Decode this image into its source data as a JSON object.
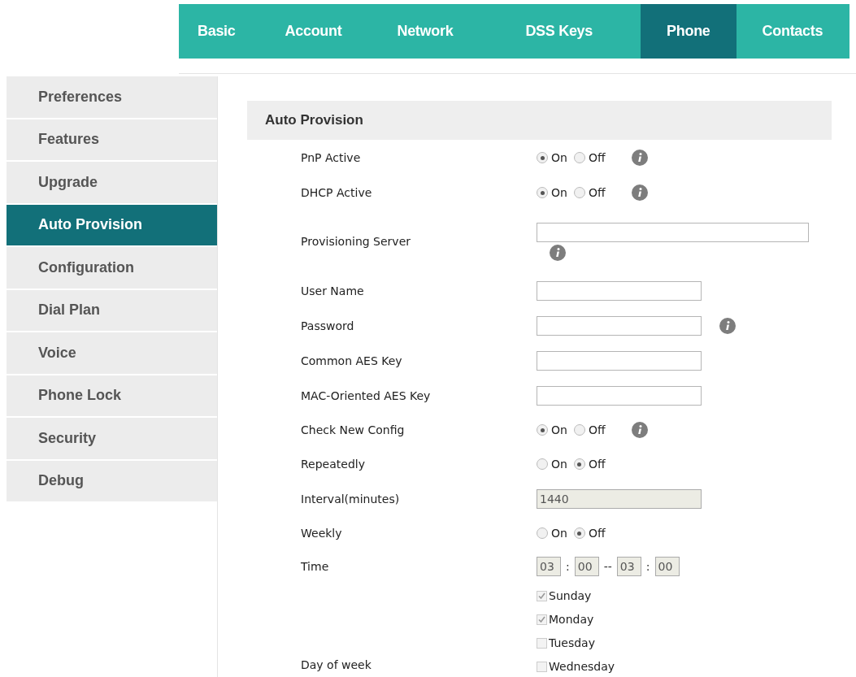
{
  "top_tabs": [
    {
      "label": "Basic",
      "selected": false
    },
    {
      "label": "Account",
      "selected": false
    },
    {
      "label": "Network",
      "selected": false
    },
    {
      "label": "DSS Keys",
      "selected": false
    },
    {
      "label": "Phone",
      "selected": true
    },
    {
      "label": "Contacts",
      "selected": false
    }
  ],
  "sidebar": {
    "items": [
      {
        "label": "Preferences",
        "selected": false
      },
      {
        "label": "Features",
        "selected": false
      },
      {
        "label": "Upgrade",
        "selected": false
      },
      {
        "label": "Auto Provision",
        "selected": true
      },
      {
        "label": "Configuration",
        "selected": false
      },
      {
        "label": "Dial Plan",
        "selected": false
      },
      {
        "label": "Voice",
        "selected": false
      },
      {
        "label": "Phone Lock",
        "selected": false
      },
      {
        "label": "Security",
        "selected": false
      },
      {
        "label": "Debug",
        "selected": false
      }
    ]
  },
  "section": {
    "title": "Auto Provision",
    "rows": [
      {
        "kind": "radio",
        "label": "PnP Active",
        "options": [
          {
            "label": "On",
            "selected": true
          },
          {
            "label": "Off",
            "selected": false
          }
        ],
        "info": true
      },
      {
        "kind": "radio",
        "label": "DHCP Active",
        "options": [
          {
            "label": "On",
            "selected": true
          },
          {
            "label": "Off",
            "selected": false
          }
        ],
        "info": true
      },
      {
        "kind": "wide_input",
        "label": "Provisioning Server",
        "info": true
      },
      {
        "kind": "input",
        "label": "User Name",
        "info": false
      },
      {
        "kind": "input",
        "label": "Password",
        "info": true
      },
      {
        "kind": "input",
        "label": "Common AES Key",
        "info": false
      },
      {
        "kind": "input",
        "label": "MAC-Oriented AES Key",
        "info": false
      },
      {
        "kind": "radio",
        "label": "Check New Config",
        "options": [
          {
            "label": "On",
            "selected": true
          },
          {
            "label": "Off",
            "selected": false
          }
        ],
        "info": true
      },
      {
        "kind": "radio",
        "label": "Repeatedly",
        "options": [
          {
            "label": "On",
            "selected": false
          },
          {
            "label": "Off",
            "selected": true
          }
        ],
        "info": false
      },
      {
        "kind": "input",
        "label": "Interval(minutes)",
        "value": "1440",
        "disabled": true,
        "info": false
      },
      {
        "kind": "radio",
        "label": "Weekly",
        "options": [
          {
            "label": "On",
            "selected": false
          },
          {
            "label": "Off",
            "selected": true
          }
        ],
        "info": false
      },
      {
        "kind": "time",
        "label": "Time",
        "parts": [
          {
            "kind": "field",
            "value": "03"
          },
          {
            "kind": "sep",
            "value": ":"
          },
          {
            "kind": "field",
            "value": "00"
          },
          {
            "kind": "sep",
            "value": "--"
          },
          {
            "kind": "field",
            "value": "03"
          },
          {
            "kind": "sep",
            "value": ":"
          },
          {
            "kind": "field",
            "value": "00"
          }
        ]
      },
      {
        "kind": "days",
        "label": "Day of week",
        "days": [
          {
            "label": "Sunday",
            "checked": true
          },
          {
            "label": "Monday",
            "checked": true
          },
          {
            "label": "Tuesday",
            "checked": false
          },
          {
            "label": "Wednesday",
            "checked": false
          }
        ]
      }
    ]
  }
}
